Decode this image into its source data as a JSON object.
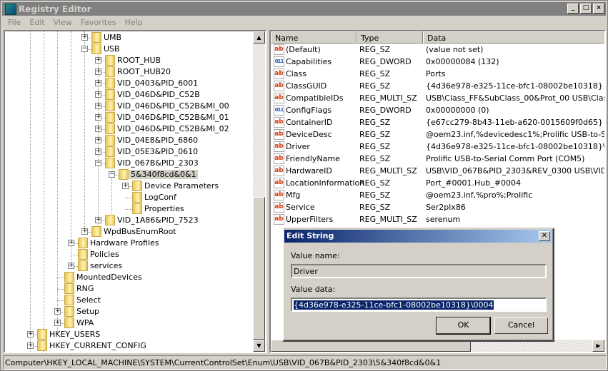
{
  "window": {
    "title": "Registry Editor",
    "buttons": [
      "_",
      "□",
      "×"
    ]
  },
  "menu": [
    "File",
    "Edit",
    "View",
    "Favorites",
    "Help"
  ],
  "tree": [
    {
      "label": "UMB",
      "level": 4,
      "expander": "+"
    },
    {
      "label": "USB",
      "level": 4,
      "expander": "-"
    },
    {
      "label": "ROOT_HUB",
      "level": 5,
      "expander": "+"
    },
    {
      "label": "ROOT_HUB20",
      "level": 5,
      "expander": "+"
    },
    {
      "label": "VID_0403&PID_6001",
      "level": 5,
      "expander": "+"
    },
    {
      "label": "VID_046D&PID_C52B",
      "level": 5,
      "expander": "+"
    },
    {
      "label": "VID_046D&PID_C52B&MI_00",
      "level": 5,
      "expander": "+"
    },
    {
      "label": "VID_046D&PID_C52B&MI_01",
      "level": 5,
      "expander": "+"
    },
    {
      "label": "VID_046D&PID_C52B&MI_02",
      "level": 5,
      "expander": "+"
    },
    {
      "label": "VID_04E8&PID_6860",
      "level": 5,
      "expander": "+"
    },
    {
      "label": "VID_05E3&PID_0610",
      "level": 5,
      "expander": "+"
    },
    {
      "label": "VID_067B&PID_2303",
      "level": 5,
      "expander": "-"
    },
    {
      "label": "5&340f8cd&0&1",
      "level": 6,
      "expander": "-",
      "selected": true
    },
    {
      "label": "Device Parameters",
      "level": 7,
      "expander": "+"
    },
    {
      "label": "LogConf",
      "level": 7,
      "expander": ""
    },
    {
      "label": "Properties",
      "level": 7,
      "expander": ""
    },
    {
      "label": "VID_1A86&PID_7523",
      "level": 5,
      "expander": "+"
    },
    {
      "label": "WpdBusEnumRoot",
      "level": 4,
      "expander": "+"
    },
    {
      "label": "Hardware Profiles",
      "level": 3,
      "expander": "+"
    },
    {
      "label": "Policies",
      "level": 3,
      "expander": ""
    },
    {
      "label": "services",
      "level": 3,
      "expander": "+"
    },
    {
      "label": "MountedDevices",
      "level": 2,
      "expander": ""
    },
    {
      "label": "RNG",
      "level": 2,
      "expander": ""
    },
    {
      "label": "Select",
      "level": 2,
      "expander": ""
    },
    {
      "label": "Setup",
      "level": 2,
      "expander": "+"
    },
    {
      "label": "WPA",
      "level": 2,
      "expander": "+"
    },
    {
      "label": "HKEY_USERS",
      "level": 0,
      "expander": "+"
    },
    {
      "label": "HKEY_CURRENT_CONFIG",
      "level": 0,
      "expander": "+"
    }
  ],
  "list": {
    "columns": [
      "Name",
      "Type",
      "Data"
    ],
    "rows": [
      {
        "icon": "string",
        "name": "(Default)",
        "type": "REG_SZ",
        "data": "(value not set)"
      },
      {
        "icon": "binary",
        "name": "Capabilities",
        "type": "REG_DWORD",
        "data": "0x00000084 (132)"
      },
      {
        "icon": "string",
        "name": "Class",
        "type": "REG_SZ",
        "data": "Ports"
      },
      {
        "icon": "string",
        "name": "ClassGUID",
        "type": "REG_SZ",
        "data": "{4d36e978-e325-11ce-bfc1-08002be10318}"
      },
      {
        "icon": "string",
        "name": "CompatibleIDs",
        "type": "REG_MULTI_SZ",
        "data": "USB\\Class_FF&SubClass_00&Prot_00 USB\\Class_FF"
      },
      {
        "icon": "binary",
        "name": "ConfigFlags",
        "type": "REG_DWORD",
        "data": "0x00000000 (0)"
      },
      {
        "icon": "string",
        "name": "ContainerID",
        "type": "REG_SZ",
        "data": "{e67cc279-8b43-11eb-a620-0015609f0d65}"
      },
      {
        "icon": "string",
        "name": "DeviceDesc",
        "type": "REG_SZ",
        "data": "@oem23.inf,%devicedesc1%;Prolific USB-to-Serial"
      },
      {
        "icon": "string",
        "name": "Driver",
        "type": "REG_SZ",
        "data": "{4d36e978-e325-11ce-bfc1-08002be10318}\\0004"
      },
      {
        "icon": "string",
        "name": "FriendlyName",
        "type": "REG_SZ",
        "data": "Prolific USB-to-Serial Comm Port (COM5)"
      },
      {
        "icon": "string",
        "name": "HardwareID",
        "type": "REG_MULTI_SZ",
        "data": "USB\\VID_067B&PID_2303&REV_0300 USB\\VID_067"
      },
      {
        "icon": "string",
        "name": "LocationInformation",
        "type": "REG_SZ",
        "data": "Port_#0001.Hub_#0004"
      },
      {
        "icon": "string",
        "name": "Mfg",
        "type": "REG_SZ",
        "data": "@oem23.inf,%pro%;Prolific"
      },
      {
        "icon": "string",
        "name": "Service",
        "type": "REG_SZ",
        "data": "Ser2plx86"
      },
      {
        "icon": "string",
        "name": "UpperFilters",
        "type": "REG_MULTI_SZ",
        "data": "serenum"
      }
    ]
  },
  "status": "Computer\\HKEY_LOCAL_MACHINE\\SYSTEM\\CurrentControlSet\\Enum\\USB\\VID_067B&PID_2303\\5&340f8cd&0&1",
  "dialog": {
    "title": "Edit String",
    "value_name_label": "Value name:",
    "value_name": "Driver",
    "value_data_label": "Value data:",
    "value_data": "{4d36e978-e325-11ce-bfc1-08002be10318}\\0004",
    "ok": "OK",
    "cancel": "Cancel"
  },
  "colors": {
    "title_active_start": "#0a246a",
    "title_active_end": "#a6caf0",
    "selection": "#0a246a",
    "string_icon": "#d03a10",
    "dword_icon": "#2050c0"
  }
}
